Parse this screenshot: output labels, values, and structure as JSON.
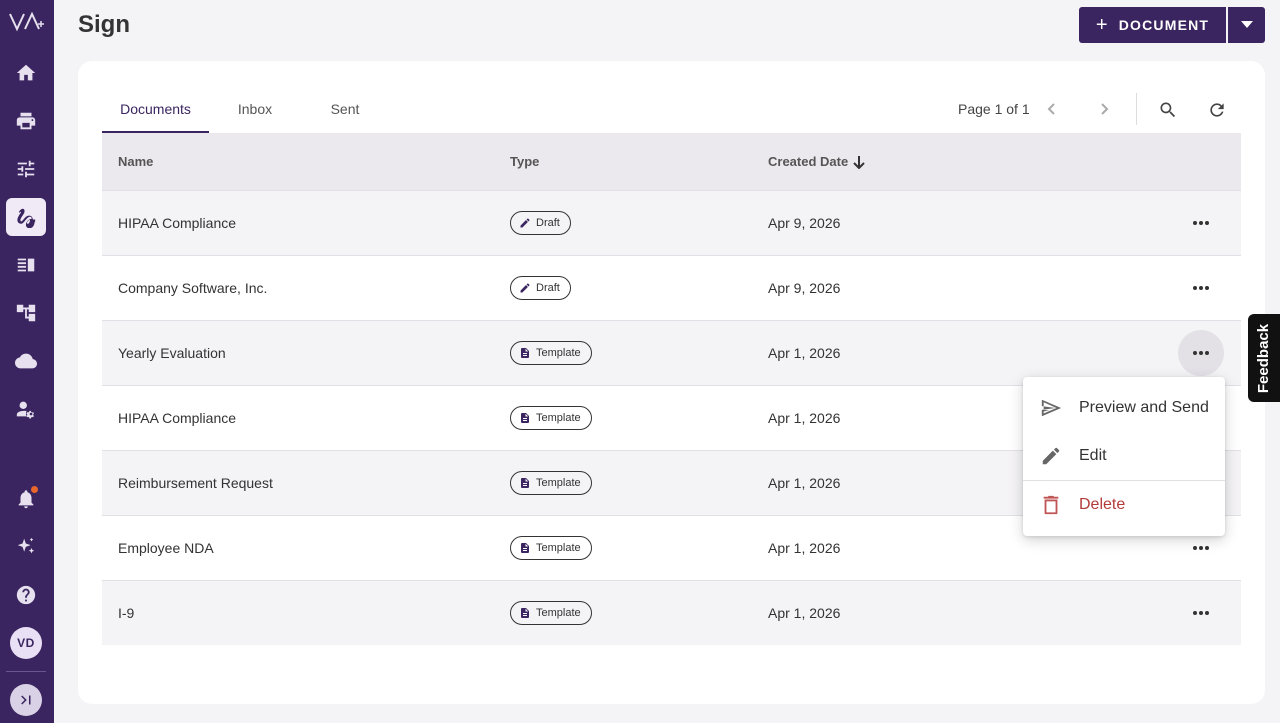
{
  "app": {
    "logo_text": "VA"
  },
  "header": {
    "title": "Sign",
    "new_doc_label": "DOCUMENT"
  },
  "sidebar": {
    "items": [
      {
        "icon": "home-icon"
      },
      {
        "icon": "print-icon"
      },
      {
        "icon": "sliders-icon"
      },
      {
        "icon": "signature-icon",
        "active": true
      },
      {
        "icon": "library-icon"
      },
      {
        "icon": "workflow-icon"
      },
      {
        "icon": "cloud-icon"
      },
      {
        "icon": "user-settings-icon"
      },
      {
        "icon": "bell-icon"
      },
      {
        "icon": "sparkle-icon"
      },
      {
        "icon": "help-icon"
      }
    ],
    "avatar_initials": "VD"
  },
  "tabs": [
    {
      "label": "Documents",
      "active": true
    },
    {
      "label": "Inbox"
    },
    {
      "label": "Sent"
    }
  ],
  "pager": {
    "text": "Page 1 of 1"
  },
  "table": {
    "columns": {
      "name": "Name",
      "type": "Type",
      "date": "Created Date"
    },
    "rows": [
      {
        "name": "HIPAA Compliance",
        "type": "Draft",
        "date": "Apr 9, 2026"
      },
      {
        "name": "Company Software, Inc.",
        "type": "Draft",
        "date": "Apr 9, 2026"
      },
      {
        "name": "Yearly Evaluation",
        "type": "Template",
        "date": "Apr 1, 2026"
      },
      {
        "name": "HIPAA Compliance",
        "type": "Template",
        "date": "Apr 1, 2026"
      },
      {
        "name": "Reimbursement Request",
        "type": "Template",
        "date": "Apr 1, 2026"
      },
      {
        "name": "Employee NDA",
        "type": "Template",
        "date": "Apr 1, 2026"
      },
      {
        "name": "I-9",
        "type": "Template",
        "date": "Apr 1, 2026"
      }
    ]
  },
  "menu": {
    "preview": "Preview and Send",
    "edit": "Edit",
    "delete": "Delete"
  },
  "feedback": {
    "label": "Feedback"
  },
  "colors": {
    "brand": "#3a2560",
    "danger": "#b43a3a",
    "notification": "#e8672c"
  }
}
